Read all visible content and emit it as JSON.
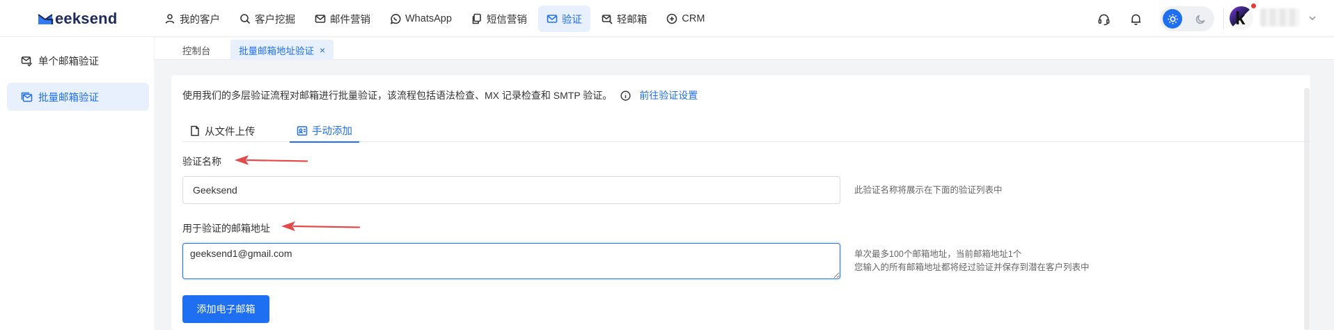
{
  "brand": {
    "name": "Geeksend",
    "text_suffix": "eeksend",
    "primary_color": "#1f6ff2",
    "text_color": "#1e2a5a"
  },
  "nav": {
    "items": [
      {
        "label": "我的客户",
        "icon": "user-icon"
      },
      {
        "label": "客户挖掘",
        "icon": "search-icon"
      },
      {
        "label": "邮件营销",
        "icon": "mail-icon"
      },
      {
        "label": "WhatsApp",
        "icon": "whatsapp-icon"
      },
      {
        "label": "短信营销",
        "icon": "sms-icon"
      },
      {
        "label": "验证",
        "icon": "mail-check-icon",
        "active": true
      },
      {
        "label": "轻邮箱",
        "icon": "light-mail-icon"
      },
      {
        "label": "CRM",
        "icon": "crm-icon"
      }
    ]
  },
  "topright": {
    "icons": [
      "headset-icon",
      "bell-icon",
      "sun-icon",
      "moon-icon",
      "avatar",
      "chevron-down-icon"
    ],
    "avatar_letter": "k"
  },
  "sidebar": {
    "items": [
      {
        "label": "单个邮箱验证",
        "icon": "mail-check-icon"
      },
      {
        "label": "批量邮箱验证",
        "icon": "mail-stack-icon",
        "active": true
      }
    ]
  },
  "page_tabs": [
    {
      "label": "控制台"
    },
    {
      "label": "批量邮箱地址验证",
      "active": true,
      "close": "×"
    }
  ],
  "content": {
    "intro": "使用我们的多层验证流程对邮箱进行批量验证，该流程包括语法检查、MX 记录检查和 SMTP 验证。",
    "intro_link": "前往验证设置",
    "tabs": [
      {
        "label": "从文件上传",
        "icon": "file-icon"
      },
      {
        "label": "手动添加",
        "icon": "contact-card-icon",
        "active": true
      }
    ],
    "form": {
      "name_label": "验证名称",
      "name_value": "Geeksend",
      "name_hint": "此验证名称将展示在下面的验证列表中",
      "emails_label": "用于验证的邮箱地址",
      "emails_value": "geeksend1@gmail.com",
      "emails_hint_1": "单次最多100个邮箱地址，当前邮箱地址1个",
      "emails_hint_2": "您输入的所有邮箱地址都将经过验证并保存到潜在客户列表中",
      "submit_label": "添加电子邮箱"
    }
  }
}
